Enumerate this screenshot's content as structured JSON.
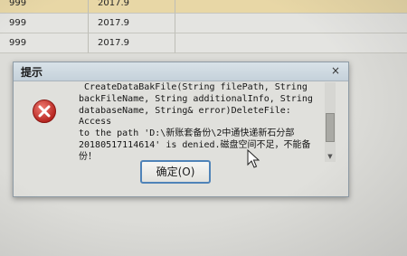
{
  "table": {
    "rows": [
      {
        "col1": "999",
        "col2": "2017.9",
        "highlighted": true
      },
      {
        "col1": "999",
        "col2": "2017.9",
        "highlighted": false
      },
      {
        "col1": "999",
        "col2": "2017.9",
        "highlighted": false
      }
    ]
  },
  "dialog": {
    "title": "提示",
    "close_symbol": "×",
    "message": " CreateDataBakFile(String filePath, String\nbackFileName, String additionalInfo, String\ndatabaseName, String& error)DeleteFile: Access\nto the path 'D:\\新账套备份\\2中通快递新石分部\n20180517114614' is denied.磁盘空间不足，不能备\n份！",
    "ok_label": "确定(O)",
    "error_icon": "error-icon",
    "colors": {
      "error_red": "#c9302c",
      "button_border": "#4f83b8",
      "highlight_row": "#e8d7a6"
    }
  }
}
